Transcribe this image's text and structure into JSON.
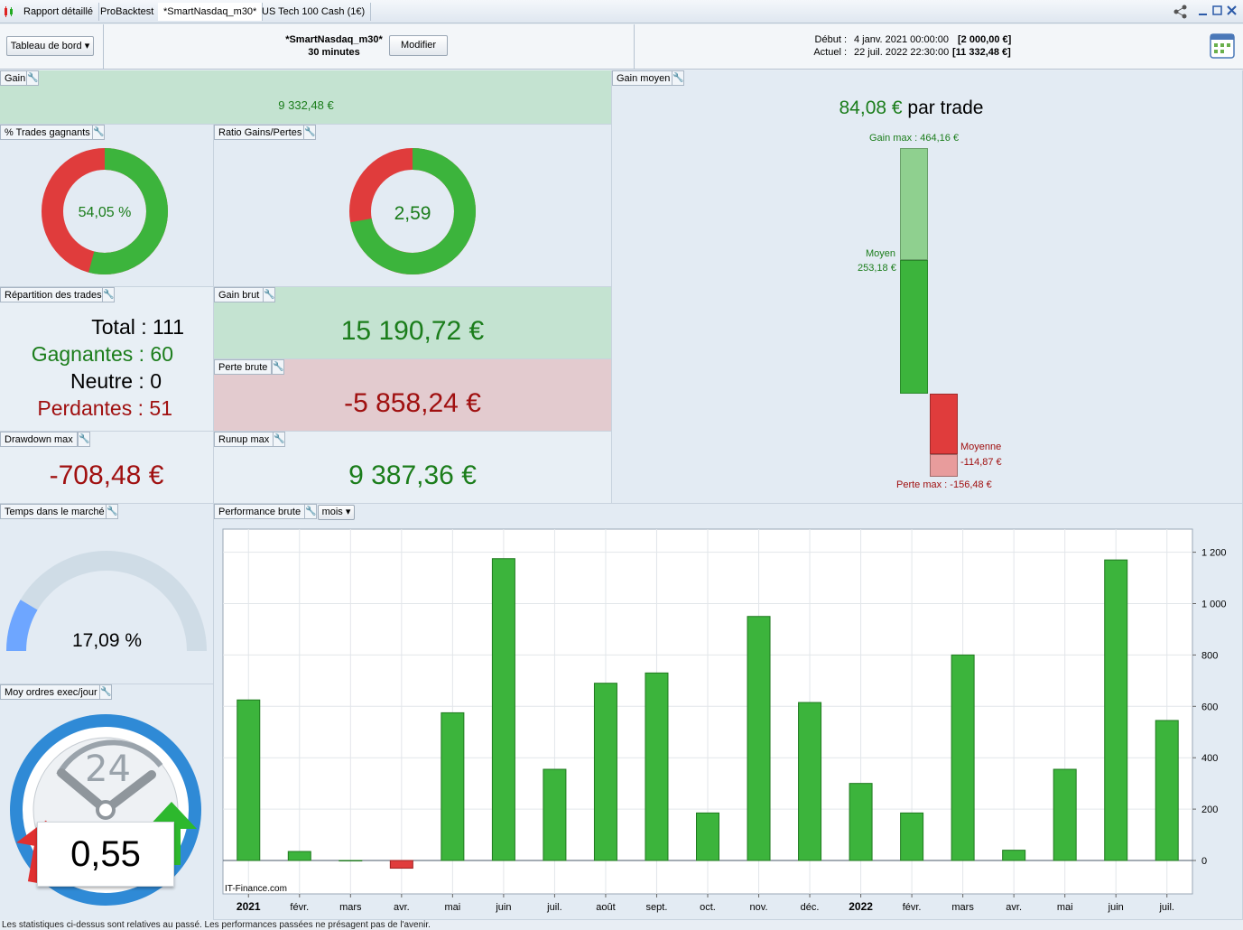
{
  "tabs": [
    {
      "label": "Rapport détaillé"
    },
    {
      "label": "ProBacktest"
    },
    {
      "label": "*SmartNasdaq_m30*"
    },
    {
      "label": "US Tech 100 Cash (1€)"
    }
  ],
  "header": {
    "dashboard_dropdown": "Tableau de bord",
    "strategy_name": "*SmartNasdaq_m30*",
    "timeframe": "30 minutes",
    "modify_button": "Modifier",
    "start_label": "Début :",
    "start_date": "4 janv. 2021 00:00:00",
    "start_capital": "[2 000,00 €]",
    "current_label": "Actuel :",
    "current_date": "22 juil. 2022 22:30:00",
    "current_capital": "[11 332,48 €]"
  },
  "gain": {
    "label": "Gain",
    "value": "9 332,48 €"
  },
  "win_pct": {
    "label": "% Trades gagnants",
    "value": "54,05 %",
    "fraction": 0.5405
  },
  "ratio": {
    "label": "Ratio Gains/Pertes",
    "value": "2,59",
    "fraction": 0.7214
  },
  "avg_gain": {
    "label": "Gain moyen",
    "value": "84,08 €",
    "suffix": "par trade",
    "gain_max_label": "Gain max : 464,16 €",
    "moyen_label": "Moyen",
    "moyen_value": "253,18 €",
    "moyenne_label": "Moyenne",
    "moyenne_value": "-114,87 €",
    "perte_max_label": "Perte max : -156,48 €",
    "gain_max": 464.16,
    "moyen": 253.18,
    "moyenne": -114.87,
    "perte_max": -156.48
  },
  "distribution": {
    "label": "Répartition des trades",
    "total_label": "Total : ",
    "total": "111",
    "win_label": "Gagnantes : ",
    "win": "60",
    "neutral_label": "Neutre : ",
    "neutral": "0",
    "loss_label": "Perdantes : ",
    "loss": "51"
  },
  "gross_gain": {
    "label": "Gain brut",
    "value": "15 190,72 €"
  },
  "gross_loss": {
    "label": "Perte brute",
    "value": "-5 858,24 €"
  },
  "drawdown": {
    "label": "Drawdown max",
    "value": "-708,48 €"
  },
  "runup": {
    "label": "Runup max",
    "value": "9 387,36 €"
  },
  "market_time": {
    "label": "Temps dans le marché",
    "value": "17,09 %",
    "fraction": 0.1709
  },
  "orders": {
    "label": "Moy ordres exec/jour",
    "value": "0,55",
    "clock_number": "24"
  },
  "performance": {
    "label": "Performance brute",
    "period": "mois"
  },
  "watermark": "IT-Finance.com",
  "footer": "Les statistiques ci-dessus sont relatives au passé. Les performances passées ne présagent pas de l'avenir.",
  "colors": {
    "green": "#3cb43c",
    "red": "#e03c3c",
    "light_green": "#8fd08f",
    "light_red": "#e89c9c",
    "blue": "#6ea6ff"
  },
  "chart_data": {
    "type": "bar",
    "categories": [
      "2021",
      "févr.",
      "mars",
      "avr.",
      "mai",
      "juin",
      "juil.",
      "août",
      "sept.",
      "oct.",
      "nov.",
      "déc.",
      "2022",
      "févr.",
      "mars",
      "avr.",
      "mai",
      "juin",
      "juil."
    ],
    "values": [
      625,
      35,
      0,
      -30,
      575,
      1175,
      355,
      690,
      730,
      185,
      950,
      615,
      300,
      185,
      800,
      40,
      355,
      1170,
      545
    ],
    "ylim": [
      -130,
      1290
    ],
    "yticks": [
      0,
      200,
      400,
      600,
      800,
      1000,
      1200
    ],
    "ytick_labels": [
      "0",
      "200",
      "400",
      "600",
      "800",
      "1 000",
      "1 200"
    ],
    "bold_categories": [
      "2021",
      "2022"
    ],
    "grid": true
  }
}
